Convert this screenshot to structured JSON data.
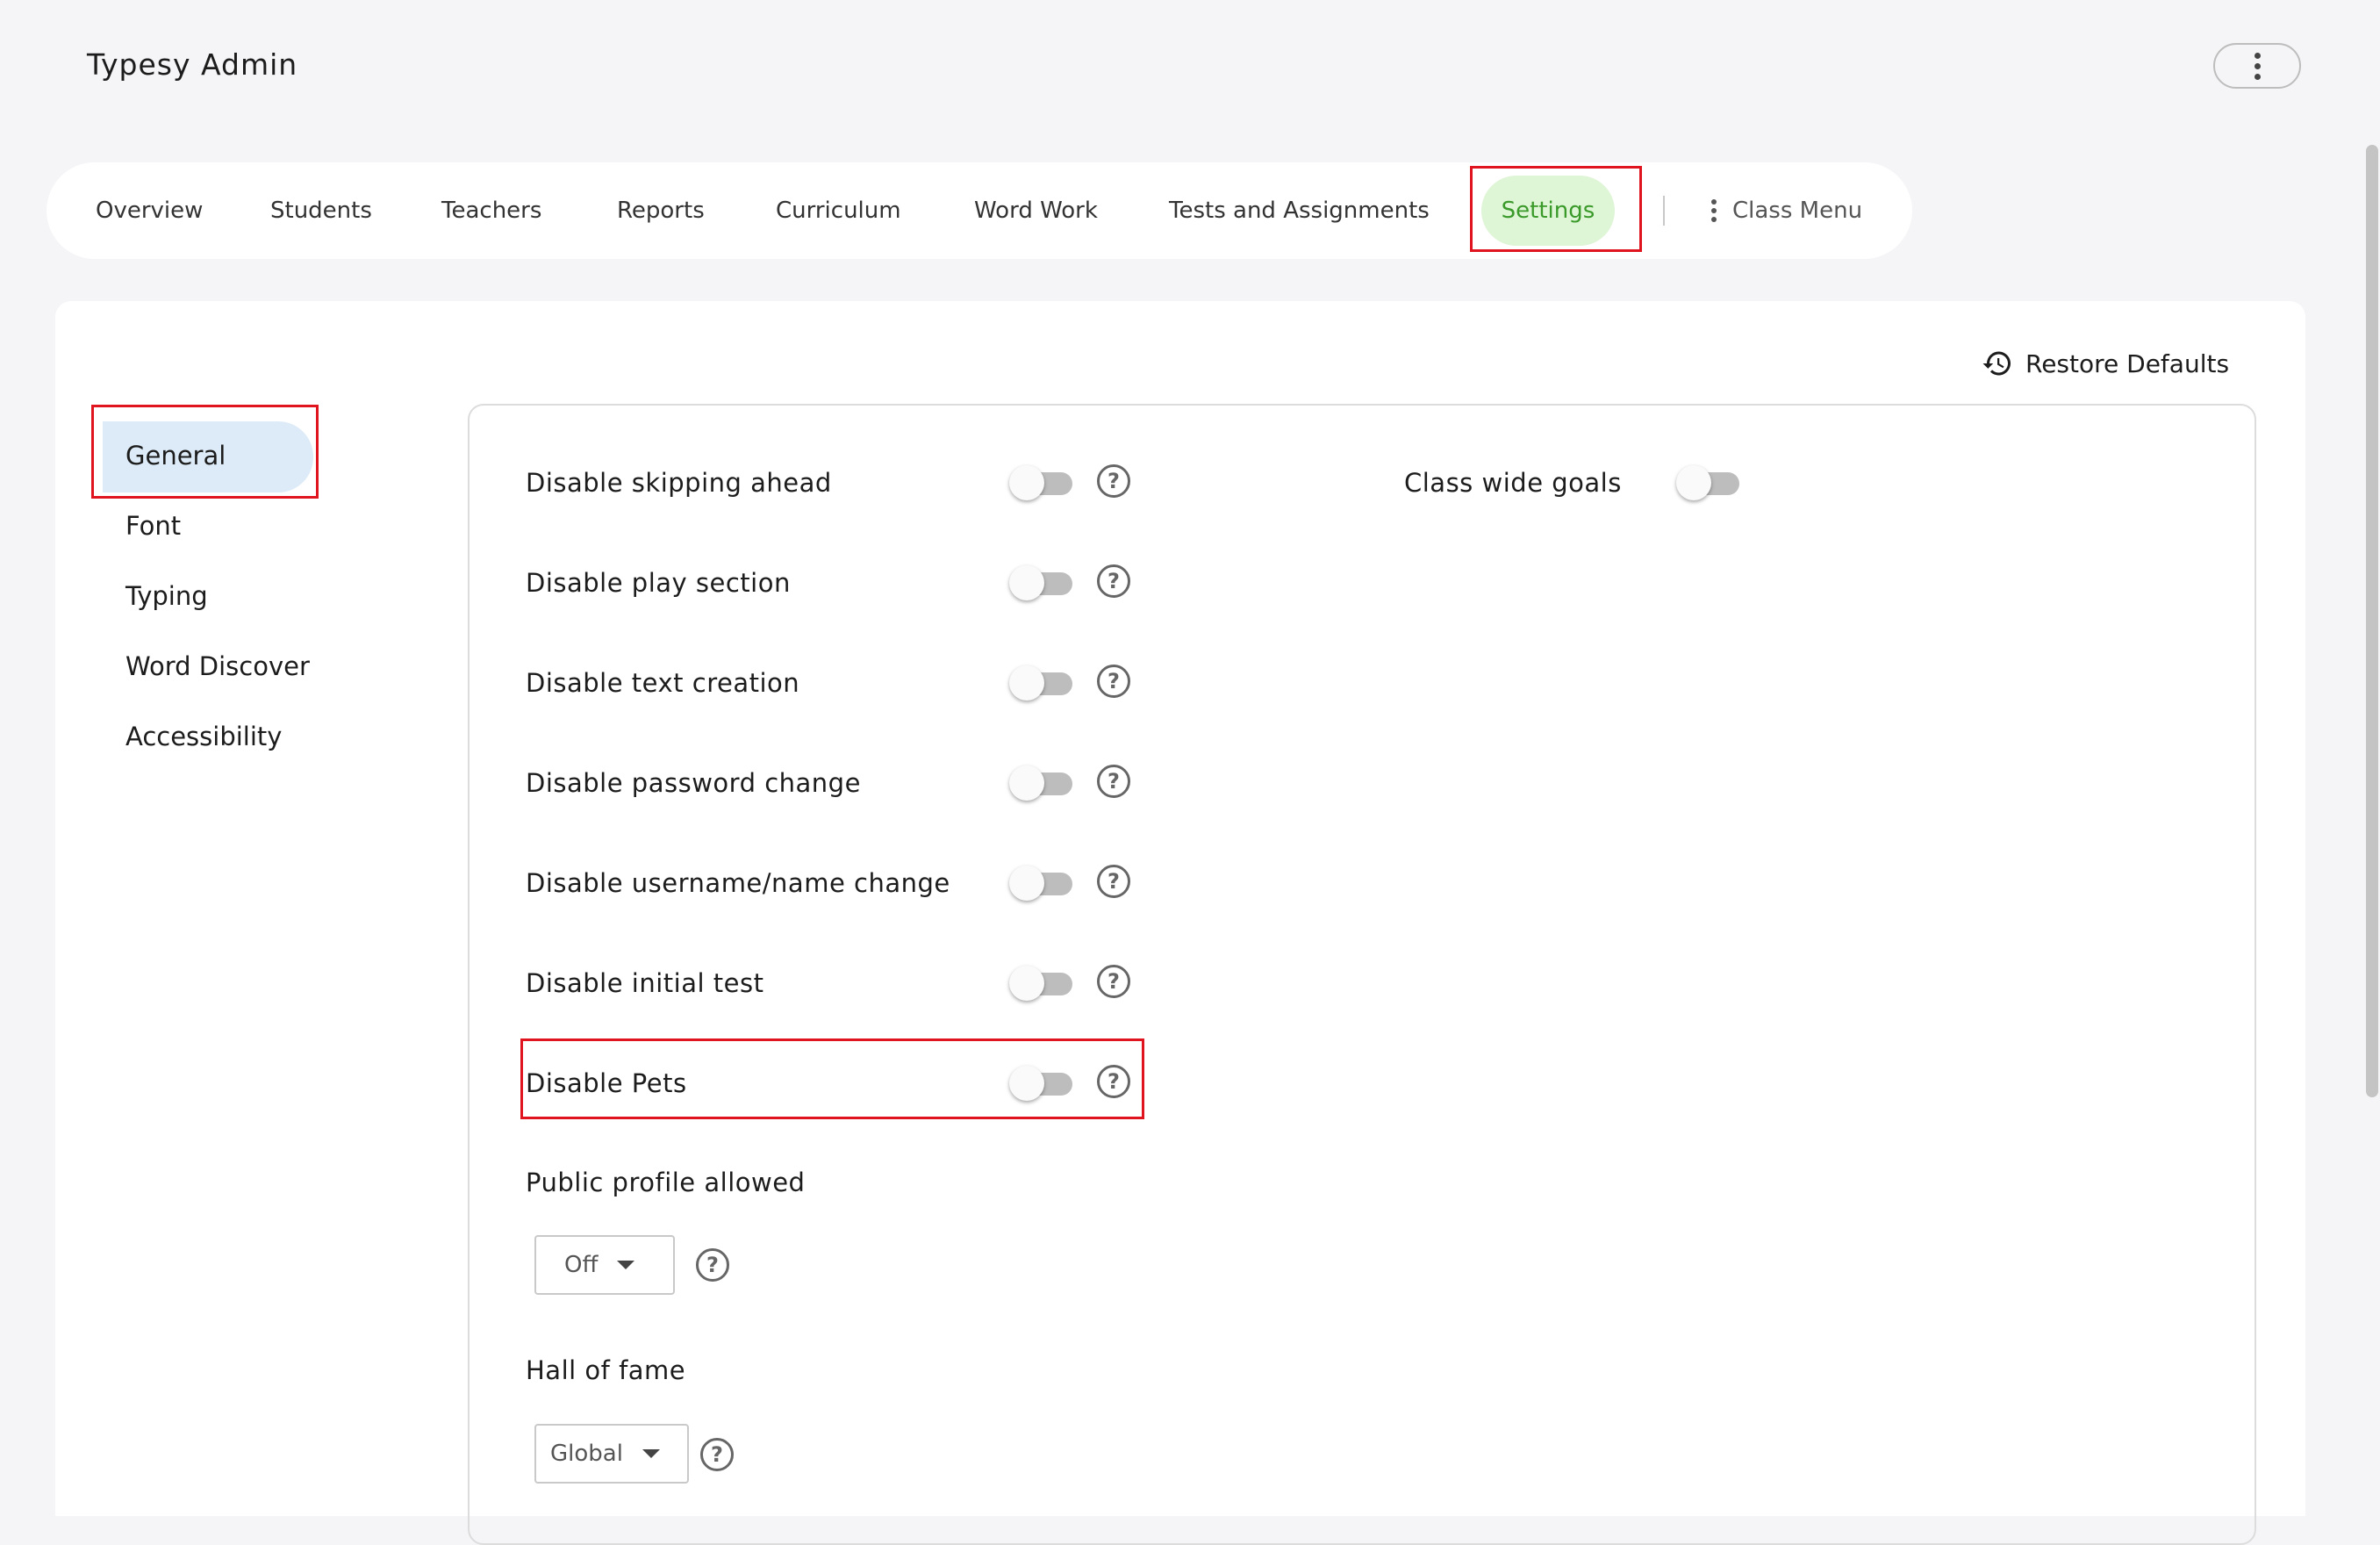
{
  "app": {
    "title": "Typesy Admin"
  },
  "tabs": [
    {
      "label": "Overview"
    },
    {
      "label": "Students"
    },
    {
      "label": "Teachers"
    },
    {
      "label": "Reports"
    },
    {
      "label": "Curriculum"
    },
    {
      "label": "Word Work"
    },
    {
      "label": "Tests and Assignments"
    },
    {
      "label": "Settings",
      "active": true
    }
  ],
  "class_menu": {
    "label": "Class Menu"
  },
  "restore": {
    "label": "Restore Defaults"
  },
  "sidebar": {
    "items": [
      {
        "label": "General",
        "active": true
      },
      {
        "label": "Font"
      },
      {
        "label": "Typing"
      },
      {
        "label": "Word Discover"
      },
      {
        "label": "Accessibility"
      }
    ]
  },
  "settings": {
    "toggles": [
      {
        "label": "Disable skipping ahead",
        "on": false
      },
      {
        "label": "Disable play section",
        "on": false
      },
      {
        "label": "Disable text creation",
        "on": false
      },
      {
        "label": "Disable password change",
        "on": false
      },
      {
        "label": "Disable username/name change",
        "on": false
      },
      {
        "label": "Disable initial test",
        "on": false
      },
      {
        "label": "Disable Pets",
        "on": false
      }
    ],
    "class_wide_goals": {
      "label": "Class wide goals",
      "on": false
    },
    "public_profile": {
      "label": "Public profile allowed",
      "value": "Off"
    },
    "hall_of_fame": {
      "label": "Hall of fame",
      "value": "Global"
    }
  },
  "colors": {
    "active_tab_bg": "#def5d6",
    "active_tab_text": "#3a9a2a",
    "active_sidebar_bg": "#dcebf7",
    "highlight": "#e0141e"
  }
}
